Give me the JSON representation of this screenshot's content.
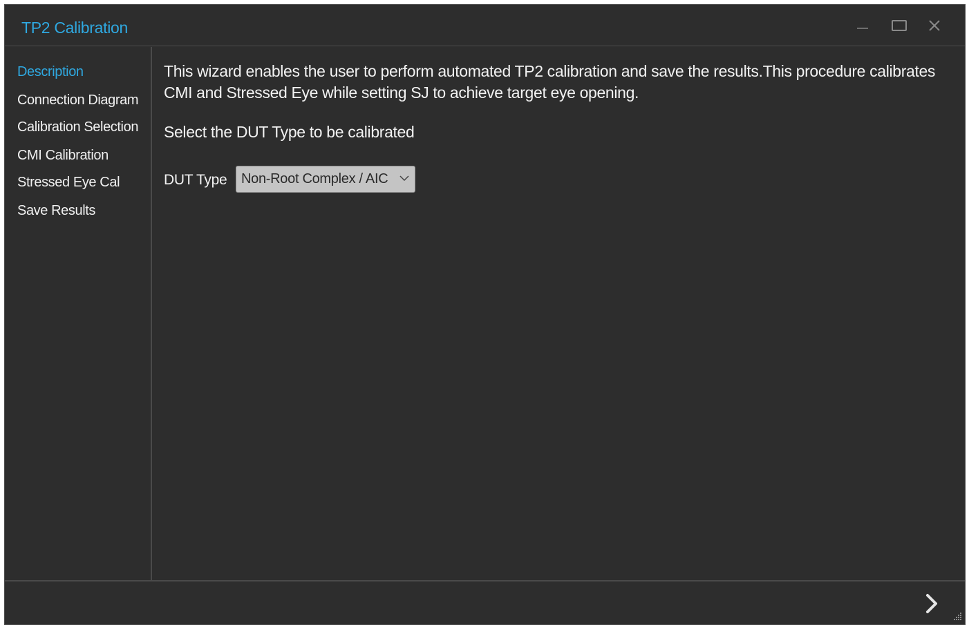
{
  "window": {
    "title": "TP2 Calibration",
    "controls": {
      "minimize": "minimize-icon",
      "maximize": "maximize-icon",
      "close": "close-icon"
    }
  },
  "sidebar": {
    "items": [
      {
        "label": "Description",
        "active": true
      },
      {
        "label": "Connection Diagram",
        "active": false
      },
      {
        "label": "Calibration Selection",
        "active": false
      },
      {
        "label": "CMI Calibration",
        "active": false
      },
      {
        "label": "Stressed Eye Cal",
        "active": false
      },
      {
        "label": "Save Results",
        "active": false
      }
    ]
  },
  "main": {
    "description": "This wizard enables the user to perform automated TP2 calibration and save the results.This procedure calibrates CMI and Stressed Eye while setting SJ to achieve target eye opening.",
    "prompt": "Select the DUT Type to be calibrated",
    "dut_type": {
      "label": "DUT Type",
      "selected": "Non-Root Complex / AIC"
    }
  },
  "footer": {
    "next_icon": "chevron-right-icon",
    "grip_icon": "resize-grip-icon"
  },
  "colors": {
    "accent": "#2fa8e0",
    "background": "#2d2d2d",
    "border": "#4a4a4a",
    "text": "#f0f0f0",
    "select_bg": "#c4c4c4"
  }
}
